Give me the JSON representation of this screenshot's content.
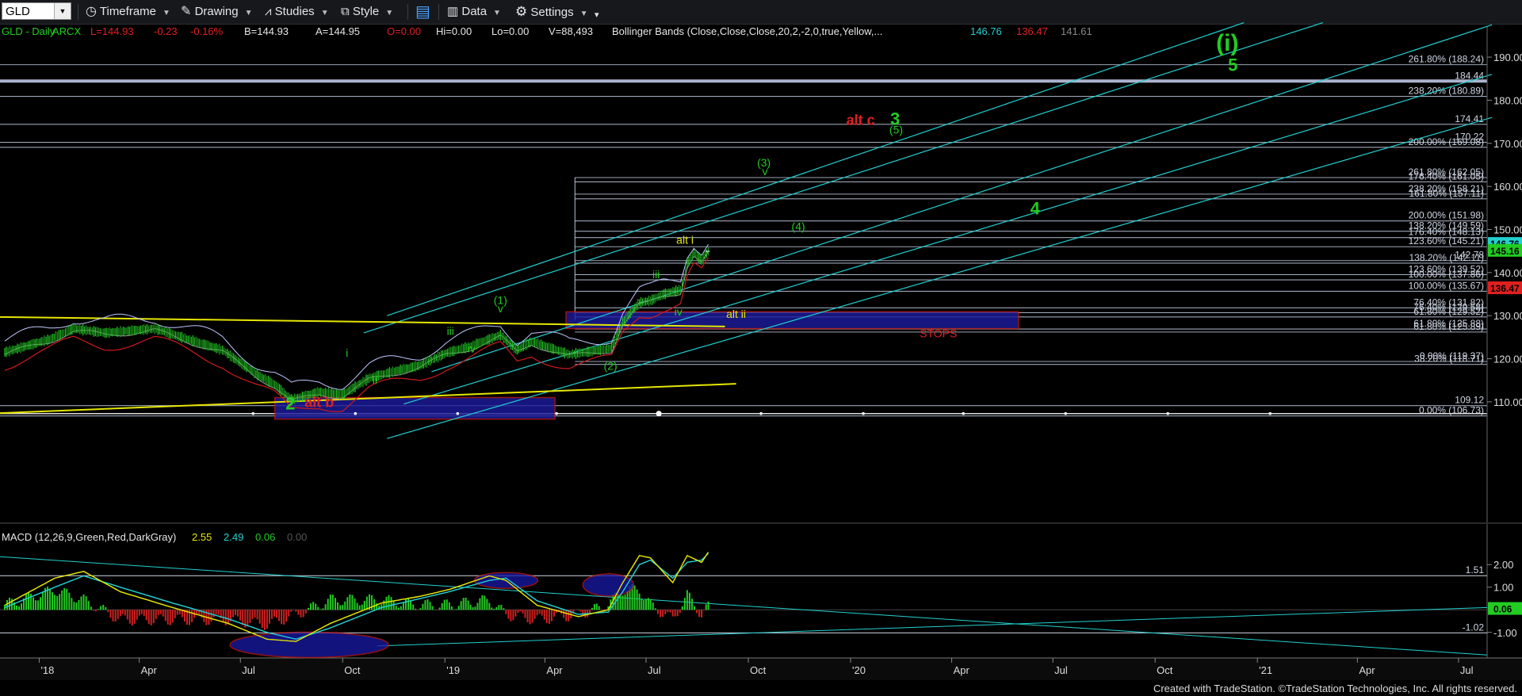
{
  "toolbar": {
    "symbol": "GLD",
    "timeframe": "Timeframe",
    "drawing": "Drawing",
    "studies": "Studies",
    "style": "Style",
    "data": "Data",
    "settings": "Settings"
  },
  "header": {
    "symbol": "GLD - Daily",
    "exchange": "ARCX",
    "last": "L=144.93",
    "change": "-0.23",
    "change_pct": "-0.16%",
    "bid": "B=144.93",
    "ask": "A=144.95",
    "open": "O=0.00",
    "high": "Hi=0.00",
    "low": "Lo=0.00",
    "volume": "V=88,493",
    "study": "Bollinger Bands (Close,Close,Close,20,2,-2,0,true,Yellow,...",
    "bb_upper": "146.76",
    "bb_lower": "136.47",
    "bb_mid": "141.61"
  },
  "macd_header": {
    "label": "MACD (12,26,9,Green,Red,DarkGray)",
    "macd": "2.55",
    "signal": "2.49",
    "hist": "0.06",
    "zero": "0.00"
  },
  "footer": "Created with TradeStation. ©TradeStation Technologies, Inc. All rights reserved.",
  "colors": {
    "up": "#22cc22",
    "down": "#e02020",
    "cyan": "#22d0d0",
    "yellow": "#e6e600",
    "fib": "#b8c4d8",
    "zone": "#1c1c9e",
    "zone_border": "#c01818"
  },
  "chart_data": [
    {
      "type": "line",
      "title": "GLD - Daily",
      "x": [
        "2017-12-01",
        "2018-01-10",
        "2018-02-01",
        "2018-03-01",
        "2018-04-15",
        "2018-05-15",
        "2018-06-15",
        "2018-07-15",
        "2018-08-01",
        "2018-08-16",
        "2018-09-10",
        "2018-10-01",
        "2018-10-25",
        "2018-11-15",
        "2018-12-10",
        "2019-01-02",
        "2019-01-25",
        "2019-02-20",
        "2019-03-07",
        "2019-03-20",
        "2019-04-23",
        "2019-05-15",
        "2019-05-31",
        "2019-06-10",
        "2019-06-25",
        "2019-07-05",
        "2019-07-17",
        "2019-08-01",
        "2019-08-07",
        "2019-08-13",
        "2019-08-20",
        "2019-08-26"
      ],
      "series": [
        {
          "values": [
            121.5,
            124.5,
            127.0,
            126.0,
            127.0,
            124.5,
            122.0,
            116.5,
            114.0,
            110.5,
            112.3,
            111.7,
            115.5,
            117.0,
            118.5,
            121.3,
            123.0,
            125.5,
            122.0,
            124.0,
            121.0,
            121.8,
            122.5,
            128.5,
            133.0,
            133.5,
            135.0,
            136.0,
            142.0,
            144.5,
            142.8,
            144.93
          ]
        }
      ],
      "ylim": [
        103,
        197
      ],
      "x_ticks": [
        "'18",
        "Apr",
        "Jul",
        "Oct",
        "'19",
        "Apr",
        "Jul",
        "Oct",
        "'20",
        "Apr",
        "Jul",
        "Oct",
        "'21",
        "Apr",
        "Jul"
      ],
      "y_ticks": [
        110.0,
        120.0,
        130.0,
        140.0,
        150.0,
        160.0,
        170.0,
        180.0,
        190.0
      ],
      "price_labels": [
        {
          "v": 188.24,
          "t": "261.80% (188.24)"
        },
        {
          "v": 184.44,
          "t": "184.44"
        },
        {
          "v": 180.89,
          "t": "238.20% (180.89)"
        },
        {
          "v": 174.41,
          "t": "174.41"
        },
        {
          "v": 170.22,
          "t": "170.22"
        },
        {
          "v": 169.08,
          "t": "200.00% (169.08)"
        },
        {
          "v": 162.05,
          "t": "261.80% (162.05)"
        },
        {
          "v": 161.05,
          "t": "176.40% (161.05)"
        },
        {
          "v": 158.21,
          "t": "238.20% (158.21)"
        },
        {
          "v": 157.11,
          "t": "161.80% (157.11)"
        },
        {
          "v": 151.98,
          "t": "200.00% (151.98)"
        },
        {
          "v": 149.59,
          "t": "138.20% (149.59)"
        },
        {
          "v": 148.13,
          "t": "176.40% (148.13)"
        },
        {
          "v": 146.0,
          "t": "123.60% (145.21)"
        },
        {
          "v": 142.78,
          "t": "142.78"
        },
        {
          "v": 142.2,
          "t": "138.20% (142.11)"
        },
        {
          "v": 139.52,
          "t": "123.60% (139.52)"
        },
        {
          "v": 138.3,
          "t": "100.00% (137.86)"
        },
        {
          "v": 135.67,
          "t": "100.00% (135.67)"
        },
        {
          "v": 131.82,
          "t": "76.40% (131.82)"
        },
        {
          "v": 130.7,
          "t": "76.40% (129.58)"
        },
        {
          "v": 129.7,
          "t": "61.80% (129.52)"
        },
        {
          "v": 126.9,
          "t": "61.80% (125.88)"
        },
        {
          "v": 126.2,
          "t": "61.80% (125.89)"
        },
        {
          "v": 119.37,
          "t": "0.00% (119.37)"
        },
        {
          "v": 118.7,
          "t": "38.20% (118.71)"
        },
        {
          "v": 109.12,
          "t": "109.12"
        },
        {
          "v": 106.73,
          "t": "0.00% (106.73)"
        }
      ],
      "badges": [
        {
          "v": 146.76,
          "t": "146.76",
          "color": "#22d0d0"
        },
        {
          "v": 145.16,
          "t": "145.16",
          "color": "#22cc22"
        },
        {
          "v": 136.47,
          "t": "136.47",
          "color": "#e02020"
        }
      ],
      "annotations": [
        {
          "t": "(i)",
          "c": "#22cc22",
          "size": 30,
          "x": "2020-12-05",
          "y": 191.5
        },
        {
          "t": "5",
          "c": "#22cc22",
          "size": 22,
          "x": "2020-12-10",
          "y": 186.8
        },
        {
          "t": "alt c",
          "c": "#e02020",
          "size": 18,
          "x": "2020-01-10",
          "y": 174.3
        },
        {
          "t": "3",
          "c": "#22cc22",
          "size": 22,
          "x": "2020-02-10",
          "y": 174.3
        },
        {
          "t": "(5)",
          "c": "#22cc22",
          "size": 14,
          "x": "2020-02-11",
          "y": 172.3
        },
        {
          "t": "(3)",
          "c": "#22cc22",
          "size": 14,
          "x": "2019-10-15",
          "y": 164.6
        },
        {
          "t": "v",
          "c": "#22cc22",
          "size": 14,
          "x": "2019-10-16",
          "y": 162.6
        },
        {
          "t": "4",
          "c": "#22cc22",
          "size": 22,
          "x": "2020-06-15",
          "y": 153.5
        },
        {
          "t": "(4)",
          "c": "#22cc22",
          "size": 14,
          "x": "2019-11-15",
          "y": 149.8
        },
        {
          "t": "alt i",
          "c": "#e6e600",
          "size": 14,
          "x": "2019-08-05",
          "y": 146.7
        },
        {
          "t": "iii",
          "c": "#22cc22",
          "size": 14,
          "x": "2019-07-10",
          "y": 138.7
        },
        {
          "t": "iv",
          "c": "#22cc22",
          "size": 14,
          "x": "2019-07-30",
          "y": 130.0
        },
        {
          "t": "alt ii",
          "c": "#e6e600",
          "size": 14,
          "x": "2019-09-20",
          "y": 129.5
        },
        {
          "t": "STOPS",
          "c": "#e02020",
          "size": 14,
          "x": "2020-03-20",
          "y": 125.0
        },
        {
          "t": "(1)",
          "c": "#22cc22",
          "size": 14,
          "x": "2019-02-20",
          "y": 132.7
        },
        {
          "t": "v",
          "c": "#22cc22",
          "size": 14,
          "x": "2019-02-20",
          "y": 130.8
        },
        {
          "t": "iii",
          "c": "#22cc22",
          "size": 14,
          "x": "2019-01-06",
          "y": 125.5
        },
        {
          "t": "iv",
          "c": "#22cc22",
          "size": 14,
          "x": "2019-01-25",
          "y": 121.5
        },
        {
          "t": "(2)",
          "c": "#22cc22",
          "size": 14,
          "x": "2019-05-30",
          "y": 117.4
        },
        {
          "t": "i",
          "c": "#22cc22",
          "size": 14,
          "x": "2018-10-05",
          "y": 120.5
        },
        {
          "t": "ii",
          "c": "#22cc22",
          "size": 14,
          "x": "2018-10-30",
          "y": 114.2
        },
        {
          "t": "2",
          "c": "#22cc22",
          "size": 22,
          "x": "2018-08-15",
          "y": 108.2
        },
        {
          "t": "alt b",
          "c": "#e02020",
          "size": 18,
          "x": "2018-09-10",
          "y": 108.8
        }
      ]
    },
    {
      "type": "line",
      "title": "MACD (12,26,9,Green,Red,DarkGray)",
      "x": [
        "2017-12-01",
        "2018-01-15",
        "2018-02-10",
        "2018-03-15",
        "2018-05-01",
        "2018-06-20",
        "2018-07-25",
        "2018-08-20",
        "2018-09-20",
        "2018-11-05",
        "2018-12-10",
        "2019-01-05",
        "2019-02-10",
        "2019-02-25",
        "2019-03-25",
        "2019-05-01",
        "2019-05-28",
        "2019-06-10",
        "2019-06-25",
        "2019-07-05",
        "2019-07-25",
        "2019-08-07",
        "2019-08-20",
        "2019-08-26"
      ],
      "series": [
        {
          "name": "MACD",
          "values": [
            0.2,
            1.4,
            1.7,
            0.8,
            0.1,
            -0.6,
            -1.3,
            -1.4,
            -0.6,
            0.3,
            0.6,
            0.9,
            1.5,
            1.3,
            0.2,
            -0.3,
            0.0,
            1.2,
            2.4,
            2.3,
            1.2,
            2.4,
            2.1,
            2.55
          ]
        },
        {
          "name": "Signal",
          "values": [
            0.1,
            1.0,
            1.5,
            1.0,
            0.3,
            -0.4,
            -1.0,
            -1.3,
            -0.8,
            0.1,
            0.5,
            0.8,
            1.3,
            1.4,
            0.4,
            -0.2,
            -0.1,
            0.8,
            2.0,
            2.2,
            1.4,
            2.1,
            2.2,
            2.49
          ]
        }
      ],
      "ylim": [
        -1.85,
        2.85
      ],
      "y_ticks": [
        -1.0,
        1.0,
        2.0
      ],
      "price_labels": [
        {
          "v": 1.51,
          "t": "1.51"
        },
        {
          "v": -1.02,
          "t": "-1.02"
        }
      ],
      "badges": [
        {
          "v": 0.06,
          "t": "0.06",
          "color": "#22cc22"
        }
      ]
    }
  ]
}
